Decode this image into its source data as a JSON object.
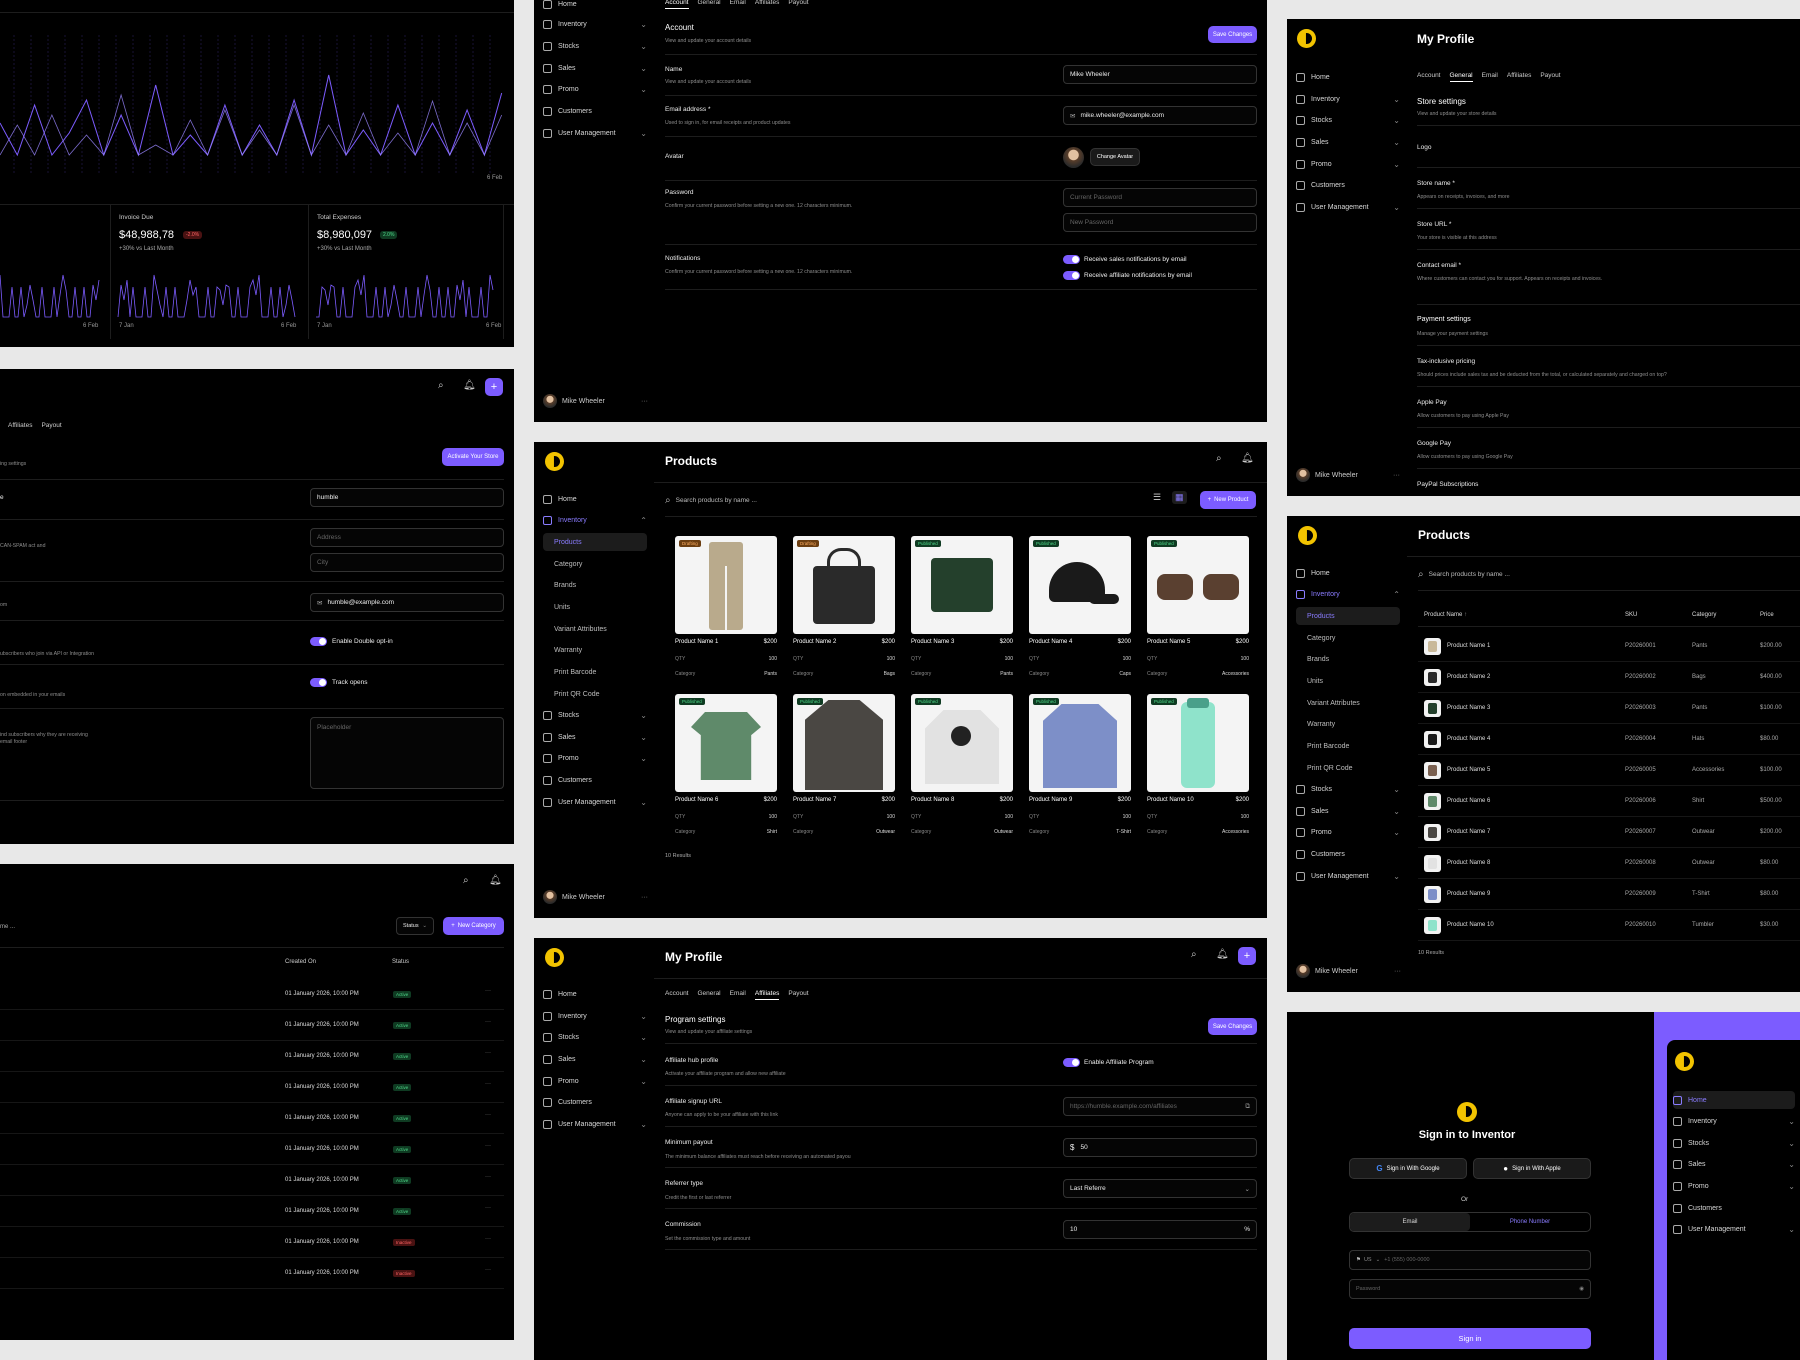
{
  "common": {
    "user_name": "Mike Wheeler",
    "nav": {
      "home": "Home",
      "inventory": "Inventory",
      "stocks": "Stocks",
      "sales": "Sales",
      "promo": "Promo",
      "customers": "Customers",
      "user_management": "User Management",
      "products": "Products",
      "category": "Category",
      "brands": "Brands",
      "units": "Units",
      "variant_attributes": "Variant Attributes",
      "warranty": "Warranty",
      "print_barcode": "Print Barcode",
      "print_qr_code": "Print QR Code"
    },
    "tabs": [
      "Account",
      "General",
      "Email",
      "Affiliates",
      "Payout"
    ],
    "save_changes": "Save Changes"
  },
  "dashboard": {
    "date_end": "6 Feb",
    "date_start": "7 Jan",
    "cards": [
      {
        "label": "Invoice Due",
        "value": "$48,988,78",
        "delta": "-2.0%",
        "note": "+30% vs Last Month"
      },
      {
        "label": "Total Expenses",
        "value": "$8,980,097",
        "delta": "2.0%",
        "note": "+30% vs Last Month"
      }
    ]
  },
  "email_settings": {
    "tabs": [
      "Affiliates",
      "Payout"
    ],
    "activate_button": "Activate Your Store",
    "frag_settings": "ing settings",
    "frag_e": "e",
    "frag_spam": "CAN-SPAM act and",
    "frag_api": "ubscribers who join via API or Integration",
    "frag_embed": "on embedded in your emails",
    "frag_why": "ind subscribers why they are receiving\nemail footer",
    "frag_m": "om",
    "sender_name": "humble",
    "address_ph": "Address",
    "city_ph": "City",
    "email_value": "humble@example.com",
    "double_optin": "Enable Double opt-in",
    "track_opens": "Track opens",
    "textarea_ph": "Placeholder"
  },
  "category_list": {
    "search_frag": "me ...",
    "status_filter": "Status",
    "new_category": "New Category",
    "col_created": "Created On",
    "col_status": "Status",
    "rows": [
      {
        "created": "01 January 2026, 10:00 PM",
        "status": "Active"
      },
      {
        "created": "01 January 2026, 10:00 PM",
        "status": "Active"
      },
      {
        "created": "01 January 2026, 10:00 PM",
        "status": "Active"
      },
      {
        "created": "01 January 2026, 10:00 PM",
        "status": "Active"
      },
      {
        "created": "01 January 2026, 10:00 PM",
        "status": "Active"
      },
      {
        "created": "01 January 2026, 10:00 PM",
        "status": "Active"
      },
      {
        "created": "01 January 2026, 10:00 PM",
        "status": "Active"
      },
      {
        "created": "01 January 2026, 10:00 PM",
        "status": "Active"
      },
      {
        "created": "01 January 2026, 10:00 PM",
        "status": "Inactive"
      },
      {
        "created": "01 January 2026, 10:00 PM",
        "status": "Inactive"
      }
    ]
  },
  "account": {
    "heading": "Account",
    "heading_desc": "View and update your account details",
    "name_label": "Name",
    "name_desc": "View and update your account details",
    "name_value": "Mike Wheeler",
    "email_label": "Email address *",
    "email_desc": "Used to sign in, for email receipts and product updates",
    "email_value": "mike.wheeler@example.com",
    "avatar_label": "Avatar",
    "change_avatar": "Change Avatar",
    "password_label": "Password",
    "password_desc": "Confirm your current password before setting a new one. 12 characters minimum.",
    "current_password_ph": "Current Password",
    "new_password_ph": "New Password",
    "notif_label": "Notifications",
    "notif_desc": "Confirm your current password before setting a new one. 12 characters minimum.",
    "notif_sales": "Receive sales notifications by email",
    "notif_affiliate": "Receive affiliate notifications by email"
  },
  "general": {
    "title": "My Profile",
    "store_settings": "Store settings",
    "store_settings_desc": "View and update your store details",
    "logo": "Logo",
    "store_name": "Store name *",
    "store_name_desc": "Appears on receipts, invoices, and more",
    "store_url": "Store URL *",
    "store_url_desc": "Your store is visible at this address",
    "contact_email": "Contact email *",
    "contact_email_desc": "Where customers can contact you for support. Appears on receipts and invoices.",
    "payment_settings": "Payment settings",
    "payment_settings_desc": "Manage your payment settings",
    "tax": "Tax-inclusive pricing",
    "tax_desc": "Should prices include sales tax and be deducted from the total, or calculated separately and charged on top?",
    "apple_pay": "Apple Pay",
    "apple_pay_desc": "Allow customers to pay using Apple Pay",
    "google_pay": "Google Pay",
    "google_pay_desc": "Allow customers to pay using Google Pay",
    "paypal": "PayPal Subscriptions"
  },
  "products_grid": {
    "title": "Products",
    "search_ph": "Search products by name ...",
    "new_product": "New Product",
    "qty_label": "QTY",
    "category_label": "Category",
    "results": "10 Results",
    "items": [
      {
        "name": "Product Name 1",
        "price": "$200",
        "qty": "100",
        "category": "Pants",
        "badge": "Drafting"
      },
      {
        "name": "Product Name 2",
        "price": "$200",
        "qty": "100",
        "category": "Bags",
        "badge": "Drafting"
      },
      {
        "name": "Product Name 3",
        "price": "$200",
        "qty": "100",
        "category": "Pants",
        "badge": "Published"
      },
      {
        "name": "Product Name 4",
        "price": "$200",
        "qty": "100",
        "category": "Caps",
        "badge": "Published"
      },
      {
        "name": "Product Name 5",
        "price": "$200",
        "qty": "100",
        "category": "Accessories",
        "badge": "Published"
      },
      {
        "name": "Product Name 6",
        "price": "$200",
        "qty": "100",
        "category": "Shirt",
        "badge": "Published"
      },
      {
        "name": "Product Name 7",
        "price": "$200",
        "qty": "100",
        "category": "Outwear",
        "badge": "Published"
      },
      {
        "name": "Product Name 8",
        "price": "$200",
        "qty": "100",
        "category": "Outwear",
        "badge": "Published"
      },
      {
        "name": "Product Name 9",
        "price": "$200",
        "qty": "100",
        "category": "T-Shirt",
        "badge": "Published"
      },
      {
        "name": "Product Name 10",
        "price": "$200",
        "qty": "100",
        "category": "Accessories",
        "badge": "Published"
      }
    ]
  },
  "products_table": {
    "title": "Products",
    "search_ph": "Search products by name ...",
    "columns": [
      "Product Name",
      "SKU",
      "Category",
      "Price"
    ],
    "results": "10 Results",
    "rows": [
      {
        "name": "Product Name 1",
        "sku": "P20260001",
        "category": "Pants",
        "price": "$200.00"
      },
      {
        "name": "Product Name 2",
        "sku": "P20260002",
        "category": "Bags",
        "price": "$400.00"
      },
      {
        "name": "Product Name 3",
        "sku": "P20260003",
        "category": "Pants",
        "price": "$100.00"
      },
      {
        "name": "Product Name 4",
        "sku": "P20260004",
        "category": "Hats",
        "price": "$80.00"
      },
      {
        "name": "Product Name 5",
        "sku": "P20260005",
        "category": "Accessories",
        "price": "$100.00"
      },
      {
        "name": "Product Name 6",
        "sku": "P20260006",
        "category": "Shirt",
        "price": "$500.00"
      },
      {
        "name": "Product Name 7",
        "sku": "P20260007",
        "category": "Outwear",
        "price": "$200.00"
      },
      {
        "name": "Product Name 8",
        "sku": "P20260008",
        "category": "Outwear",
        "price": "$80.00"
      },
      {
        "name": "Product Name 9",
        "sku": "P20260009",
        "category": "T-Shirt",
        "price": "$80.00"
      },
      {
        "name": "Product Name 10",
        "sku": "P20260010",
        "category": "Tumbler",
        "price": "$30.00"
      }
    ]
  },
  "affiliates": {
    "title": "My Profile",
    "program": "Program settings",
    "program_desc": "View and update your affiliate settings",
    "hub": "Affiliate hub profile",
    "hub_desc": "Activate your affiliate program and allow new affiliate",
    "enable_affiliate": "Enable Affiliate Program",
    "signup": "Affiliate signup URL",
    "signup_desc": "Anyone can apply to be your affiliate with this link",
    "signup_value": "https://humble.example.com/affiliates",
    "minpay": "Minimum payout",
    "minpay_desc": "The minimum balance affiliates must reach before receiving an automated payou",
    "minpay_value": "50",
    "currency": "$",
    "referrer": "Referrer type",
    "referrer_desc": "Credit the first or last referrer",
    "referrer_value": "Last Referre",
    "commission": "Commission",
    "commission_desc": "Set the commission type and amount",
    "commission_value": "10",
    "percent": "%"
  },
  "signin": {
    "title": "Sign in to Inventor",
    "google": "Sign in With Google",
    "apple": "Sign in With Apple",
    "or": "Or",
    "tab_email": "Email",
    "tab_phone": "Phone Number",
    "country": "US",
    "phone_ph": "+1 (555) 000-0000",
    "password_ph": "Password",
    "button": "Sign in"
  }
}
